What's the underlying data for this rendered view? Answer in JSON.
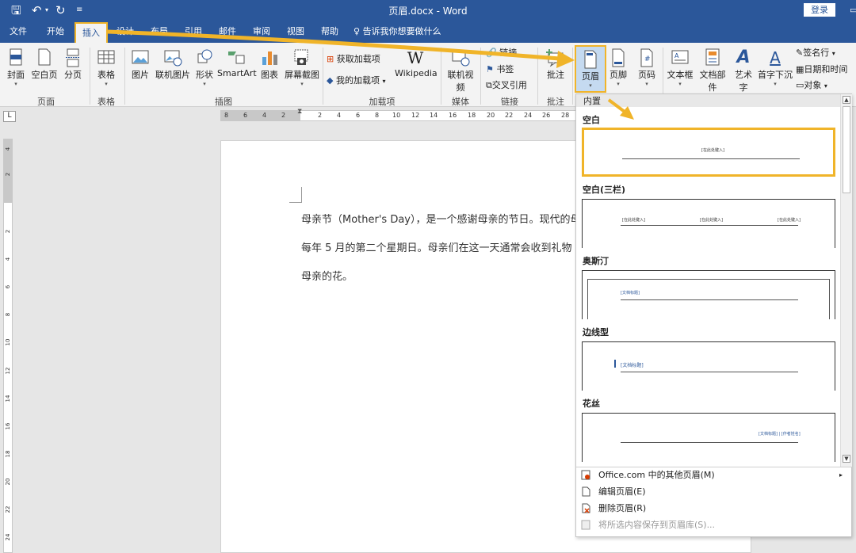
{
  "titlebar": {
    "doc_title": "页眉.docx - Word",
    "login": "登录",
    "qat_save": "🖫",
    "qat_undo": "↶",
    "qat_redo": "↻"
  },
  "tabs": [
    "文件",
    "开始",
    "插入",
    "设计",
    "布局",
    "引用",
    "邮件",
    "审阅",
    "视图",
    "帮助"
  ],
  "tell_me": "告诉我你想要做什么",
  "ribbon": {
    "pages": {
      "cover": "封面",
      "blank": "空白页",
      "break": "分页",
      "group": "页面"
    },
    "tables": {
      "table": "表格",
      "group": "表格"
    },
    "illustrations": {
      "picture": "图片",
      "online_picture": "联机图片",
      "shapes": "形状",
      "smartart": "SmartArt",
      "chart": "图表",
      "screenshot": "屏幕截图",
      "group": "插图"
    },
    "addins": {
      "get": "获取加载项",
      "my": "我的加载项",
      "wikipedia": "Wikipedia",
      "group": "加载项"
    },
    "media": {
      "online_video": "联机视频",
      "group": "媒体"
    },
    "links": {
      "link": "链接",
      "bookmark": "书签",
      "cross_ref": "交叉引用",
      "group": "链接"
    },
    "comments": {
      "comment": "批注",
      "group": "批注"
    },
    "header_footer": {
      "header": "页眉",
      "footer": "页脚",
      "page_number": "页码"
    },
    "text": {
      "textbox": "文本框",
      "quickparts": "文档部件",
      "wordart": "艺术字",
      "dropcap": "首字下沉",
      "signature": "签名行",
      "datetime": "日期和时间",
      "object": "对象"
    }
  },
  "ruler": [
    "8",
    "6",
    "4",
    "2",
    "2",
    "4",
    "6",
    "8",
    "10",
    "12",
    "14",
    "16",
    "18",
    "20",
    "22",
    "24",
    "26",
    "28"
  ],
  "vruler": [
    "4",
    "2",
    "2",
    "4",
    "6",
    "8",
    "10",
    "12",
    "14",
    "16",
    "18",
    "20",
    "22",
    "24"
  ],
  "document": {
    "line1": "母亲节（Mother's Day），是一个感谢母亲的节日。现代的母",
    "line2": "每年 5 月的第二个星期日。母亲们在这一天通常会收到礼物",
    "line3": "母亲的花。"
  },
  "dropdown": {
    "section": "内置",
    "galleries": [
      {
        "name": "空白",
        "placeholders": [
          "[在此处键入]"
        ]
      },
      {
        "name": "空白(三栏)",
        "placeholders": [
          "[在此处键入]",
          "[在此处键入]",
          "[在此处键入]"
        ]
      },
      {
        "name": "奥斯汀",
        "placeholders": [
          "[文档标题]"
        ]
      },
      {
        "name": "边线型",
        "placeholders": [
          "[文档标题]"
        ]
      },
      {
        "name": "花丝",
        "placeholders": [
          "[文档标题] | [作者姓名]"
        ]
      }
    ],
    "menu": [
      {
        "label": "Office.com 中的其他页眉(M)",
        "disabled": false
      },
      {
        "label": "编辑页眉(E)",
        "disabled": false
      },
      {
        "label": "删除页眉(R)",
        "disabled": false
      },
      {
        "label": "将所选内容保存到页眉库(S)...",
        "disabled": true
      }
    ]
  },
  "colors": {
    "brand": "#2b579a",
    "highlight": "#f0b429"
  }
}
